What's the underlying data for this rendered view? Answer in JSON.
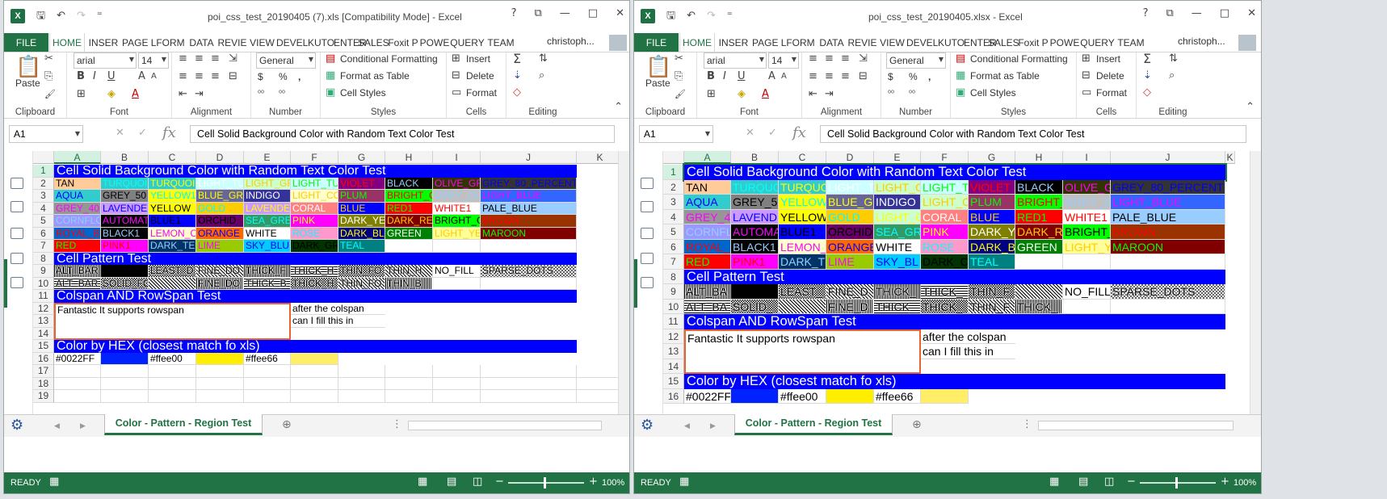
{
  "left": {
    "title": "poi_css_test_20190405 (7).xls  [Compatibility Mode] - Excel",
    "tabs": [
      "FILE",
      "HOME",
      "INSER",
      "PAGE L",
      "FORM",
      "DATA",
      "REVIE",
      "VIEW",
      "DEVEL",
      "KUTO",
      "ENTER",
      "SALES",
      "Foxit P",
      "POWE",
      "QUERY",
      "TEAM"
    ],
    "user": "christoph...",
    "font": "arial",
    "fontsize": "14",
    "numfmt": "General",
    "namebox": "A1",
    "formula": "Cell Solid Background Color with Random Text Color Test",
    "columns": [
      "A",
      "B",
      "C",
      "D",
      "E",
      "F",
      "G",
      "H",
      "I",
      "J",
      "K"
    ],
    "rows": [
      "1",
      "2",
      "3",
      "4",
      "5",
      "6",
      "7",
      "8",
      "9",
      "10",
      "11",
      "12",
      "13",
      "14",
      "15",
      "16",
      "17",
      "18",
      "19"
    ],
    "sheet_tab": "Color - Pattern - Region Test",
    "status": "READY",
    "zoom": "100%"
  },
  "right": {
    "title": "poi_css_test_20190405.xlsx - Excel",
    "tabs": [
      "FILE",
      "HOME",
      "INSER",
      "PAGE L",
      "FORM",
      "DATA",
      "REVIE",
      "VIEW",
      "DEVEL",
      "KUTO",
      "ENTER",
      "SALES",
      "Foxit P",
      "POWE",
      "QUERY",
      "TEAM"
    ],
    "user": "christoph...",
    "font": "arial",
    "fontsize": "14",
    "numfmt": "General",
    "namebox": "A1",
    "formula": "Cell Solid Background Color with Random Text Color Test",
    "columns": [
      "A",
      "B",
      "C",
      "D",
      "E",
      "F",
      "G",
      "H",
      "I",
      "J",
      "K"
    ],
    "rows": [
      "1",
      "2",
      "3",
      "4",
      "5",
      "6",
      "7",
      "8",
      "9",
      "10",
      "11",
      "12",
      "13",
      "14",
      "15",
      "16"
    ],
    "sheet_tab": "Color - Pattern - Region Test",
    "status": "READY",
    "zoom": "100%"
  },
  "ribbon": {
    "paste": "Paste",
    "clipboard": "Clipboard",
    "font_group": "Font",
    "alignment": "Alignment",
    "number": "Number",
    "styles": "Styles",
    "cells": "Cells",
    "editing": "Editing",
    "cond_format": "Conditional Formatting",
    "format_table": "Format as Table",
    "cell_styles": "Cell Styles",
    "insert": "Insert",
    "delete": "Delete",
    "format": "Format",
    "currency": "$",
    "percent": "%",
    "comma": ","
  },
  "sheet": {
    "section1": "Cell Solid Background Color with Random Text Color Test",
    "section2": "Cell Pattern Test",
    "section3": "Colspan AND RowSpan Test",
    "section4": "Color by HEX (closest match fo xls)",
    "rowspan_text": "Fantastic It supports rowspan",
    "colspan_text1": "after the colspan",
    "colspan_text2": "can I fill this in",
    "left_colors": [
      [
        "TAN",
        "TURQUOI",
        "TURQUOI",
        "LIGHT_TU",
        "LIGHT_GR",
        "LIGHT_TU",
        "VIOLET",
        "BLACK",
        "OLIVE_GR",
        "GREY_80_PERCENT"
      ],
      [
        "AQUA",
        "GREY_50",
        "YELLOW1",
        "BLUE_GR",
        "INDIGO",
        "LIGHT_CO",
        "PLUM",
        "BRIGHT_G",
        "GREY_25",
        "LIGHT_BLUE"
      ],
      [
        "GREY_40",
        "LAVENDE",
        "YELLOW",
        "GOLD",
        "LAVENDER",
        "CORAL",
        "BLUE",
        "RED1",
        "WHITE1",
        "PALE_BLUE"
      ],
      [
        "CORNFLO",
        "AUTOMAT",
        "BLUE1",
        "ORCHID",
        "SEA_GRE",
        "PINK",
        "DARK_YE",
        "DARK_RE",
        "BRIGHT_G",
        "BROWN"
      ],
      [
        "ROYAL_BL",
        "BLACK1",
        "LEMON_C",
        "ORANGE",
        "WHITE",
        "ROSE",
        "DARK_BLU",
        "GREEN",
        "LIGHT_YE",
        "MAROON"
      ],
      [
        "RED",
        "PINK1",
        "DARK_TE",
        "LIME",
        "SKY_BLU",
        "DARK_GR",
        "TEAL",
        "",
        "",
        ""
      ]
    ],
    "right_colors": [
      [
        "TAN",
        "TURQUO",
        "TURQUO",
        "LIGHT_T",
        "LIGHT_C",
        "LIGHT_T",
        "VIOLET",
        "BLACK",
        "OLIVE_G",
        "GREY_80_PERCENT"
      ],
      [
        "AQUA",
        "GREY_5",
        "YELLOW",
        "BLUE_G",
        "INDIGO",
        "LIGHT_C",
        "PLUM",
        "BRIGHT_",
        "GREY_2",
        "LIGHT_BLUE"
      ],
      [
        "GREY_4",
        "LAVEND",
        "YELLOW",
        "GOLD",
        "LIGHT_C",
        "CORAL",
        "BLUE",
        "RED1",
        "WHITE1",
        "PALE_BLUE"
      ],
      [
        "CORNFL",
        "AUTOMA",
        "BLUE1",
        "ORCHID",
        "SEA_GR",
        "PINK",
        "DARK_Y",
        "DARK_R",
        "BRIGHT_",
        "BROWN"
      ],
      [
        "ROYAL_",
        "BLACK1",
        "LEMON_",
        "ORANGE",
        "WHITE",
        "ROSE",
        "DARK_B",
        "GREEN",
        "LIGHT_Y",
        "MAROON"
      ],
      [
        "RED",
        "PINK1",
        "DARK_T",
        "LIME",
        "SKY_BL",
        "DARK_C",
        "TEAL",
        "",
        "",
        ""
      ]
    ],
    "left_pattern9": [
      "ALT_BAR",
      "",
      "LEAST_D",
      "FINE_DO",
      "THICK_F",
      "THICK_H",
      "THIN_FO",
      "THIN_H",
      "NO_FILL",
      "SPARSE_DOTS"
    ],
    "left_pattern10": [
      "ALT_BAR",
      "SOLID_FO",
      "",
      "FINE_DO",
      "THICK_B",
      "THICK_H",
      "THIN_FO",
      "THIN_B",
      "",
      ""
    ],
    "right_pattern9": [
      "ALT_BA",
      "",
      "LEAST_",
      "FINE_D",
      "THICK_",
      "THICK_",
      "THIN_F",
      "",
      "NO_FILL",
      "SPARSE_DOTS"
    ],
    "right_pattern10": [
      "ALT_BA",
      "SOLID_",
      "",
      "FINE_D",
      "THICK_",
      "THICK_",
      "THIN_F",
      "THICK_",
      "",
      ""
    ],
    "hex_row": [
      "#0022FF",
      "",
      "#ffee00",
      "",
      "#ffee66",
      ""
    ]
  },
  "colors": {
    "excel_green": "#217346",
    "band_blue": "#0000ff",
    "merge_border": "#e8642c"
  }
}
